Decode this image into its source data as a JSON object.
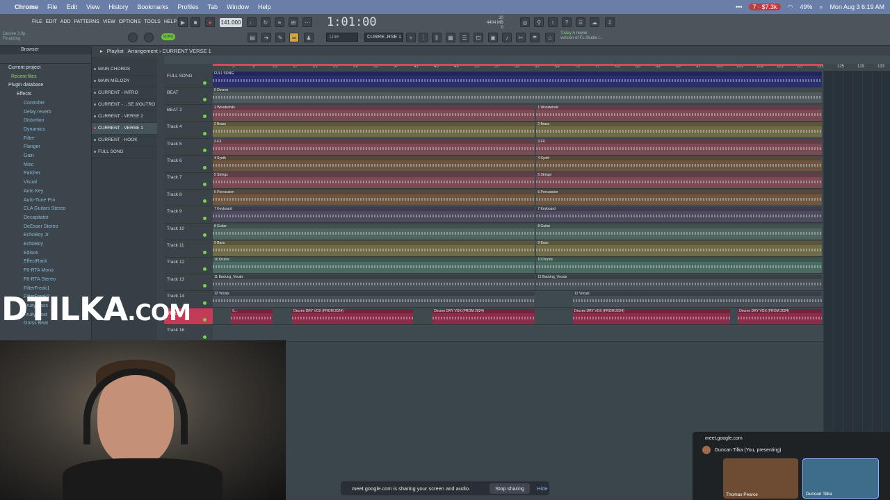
{
  "menubar": {
    "app": "Chrome",
    "items": [
      "File",
      "Edit",
      "View",
      "History",
      "Bookmarks",
      "Profiles",
      "Tab",
      "Window",
      "Help"
    ],
    "badge": "7 · $7.3k",
    "battery": "49%",
    "datetime": "Mon Aug 3  6:19 AM"
  },
  "fl": {
    "menu": [
      "FILE",
      "EDIT",
      "ADD",
      "PATTERNS",
      "VIEW",
      "OPTIONS",
      "TOOLS",
      "HELP"
    ],
    "hint": [
      "Decree 3.flp",
      "Finalizing"
    ],
    "song_toggle": "SONG",
    "bpm": "141.000",
    "time": "1:01:00",
    "cpu": [
      "10",
      "4404 MB",
      "0"
    ],
    "snap": "Line",
    "pattern": "CURRE..RSE 1",
    "news": [
      "Today",
      "A newer",
      "version of FL Studio i..."
    ]
  },
  "browser": {
    "title": "Browser",
    "items": [
      {
        "label": "Current project",
        "type": "folder"
      },
      {
        "label": "Recent files",
        "type": "green"
      },
      {
        "label": "Plugin database",
        "type": "folder"
      },
      {
        "label": "Effects",
        "type": "folder"
      },
      {
        "label": "Controller",
        "type": "blue"
      },
      {
        "label": "Delay reverb",
        "type": "blue"
      },
      {
        "label": "Distortion",
        "type": "blue"
      },
      {
        "label": "Dynamics",
        "type": "blue"
      },
      {
        "label": "Filter",
        "type": "blue"
      },
      {
        "label": "Flanger",
        "type": "blue"
      },
      {
        "label": "Gain",
        "type": "blue"
      },
      {
        "label": "Misc",
        "type": "blue"
      },
      {
        "label": "Patcher",
        "type": "blue"
      },
      {
        "label": "Visual",
        "type": "blue"
      },
      {
        "label": "Auto Key",
        "type": "blue"
      },
      {
        "label": "Auto-Tune Pro",
        "type": "blue"
      },
      {
        "label": "CLA Guitars Stereo",
        "type": "blue"
      },
      {
        "label": "Decapitator",
        "type": "blue"
      },
      {
        "label": "DeEsser Stereo",
        "type": "blue"
      },
      {
        "label": "EchoBoy Jr",
        "type": "blue"
      },
      {
        "label": "EchoBoy",
        "type": "blue"
      },
      {
        "label": "Edison",
        "type": "blue"
      },
      {
        "label": "EffectRack",
        "type": "blue"
      },
      {
        "label": "F6-RTA Mono",
        "type": "blue"
      },
      {
        "label": "F6-RTA Stereo",
        "type": "blue"
      },
      {
        "label": "FilterFreak1",
        "type": "blue"
      },
      {
        "label": "FilterFreak2",
        "type": "blue"
      },
      {
        "label": "Fruity Bass",
        "type": "blue"
      },
      {
        "label": "Fruity Beat",
        "type": "blue"
      },
      {
        "label": "Gross Beat",
        "type": "blue"
      }
    ]
  },
  "patterns": [
    "MAIN CHORDS",
    "MAIN MELODY",
    "CURRENT - INTRO",
    "CURRENT - ...SE 3/OUTRO",
    "CURRENT - VERSE 2",
    "CURRENT - VERSE 1",
    "CURRENT - HOOK",
    "FULL SONG"
  ],
  "active_pattern": "CURRENT - VERSE 1",
  "playlist": {
    "title": "Playlist",
    "breadcrumb": "Arrangement  ›  CURRENT  VERSE 1",
    "ruler": [
      "5",
      "9",
      "13",
      "17",
      "21",
      "25",
      "29",
      "33",
      "37",
      "41",
      "45",
      "49",
      "53",
      "57",
      "61",
      "65",
      "69",
      "73",
      "77",
      "81",
      "85",
      "89",
      "93",
      "97",
      "101",
      "105",
      "109",
      "113",
      "117",
      "121",
      "125",
      "129",
      "133"
    ],
    "tracks": [
      {
        "name": "FULL SONG",
        "color": "#2b2e6e",
        "clips": [
          {
            "label": "FULL SONG",
            "start": 0,
            "len": 1
          }
        ]
      },
      {
        "name": "BEAT",
        "color": "#50595d",
        "clips": [
          {
            "label": "0 Decree",
            "start": 0,
            "len": 1
          }
        ]
      },
      {
        "name": "BEAT 2",
        "color": "#7a4a55",
        "clips": [
          {
            "label": "1 Woodwinds",
            "start": 0,
            "len": 0.53
          },
          {
            "label": "1 Woodwinds",
            "start": 0.53,
            "len": 0.47
          }
        ]
      },
      {
        "name": "Track 4",
        "color": "#6f6a47",
        "clips": [
          {
            "label": "2 Brass",
            "start": 0,
            "len": 0.53
          },
          {
            "label": "2 Brass",
            "start": 0.53,
            "len": 0.47
          }
        ]
      },
      {
        "name": "Track 5",
        "color": "#7a4a55",
        "clips": [
          {
            "label": "3 FX",
            "start": 0,
            "len": 0.53
          },
          {
            "label": "3 FX",
            "start": 0.53,
            "len": 0.47
          }
        ]
      },
      {
        "name": "Track 6",
        "color": "#6c5642",
        "clips": [
          {
            "label": "4 Synth",
            "start": 0,
            "len": 0.53
          },
          {
            "label": "4 Synth",
            "start": 0.53,
            "len": 0.47
          }
        ]
      },
      {
        "name": "Track 7",
        "color": "#7a4a55",
        "clips": [
          {
            "label": "5 Strings",
            "start": 0,
            "len": 0.53
          },
          {
            "label": "5 Strings",
            "start": 0.53,
            "len": 0.47
          }
        ]
      },
      {
        "name": "Track 8",
        "color": "#6c5642",
        "clips": [
          {
            "label": "6 Percussion",
            "start": 0,
            "len": 0.53
          },
          {
            "label": "6 Percussion",
            "start": 0.53,
            "len": 0.47
          }
        ]
      },
      {
        "name": "Track 9",
        "color": "#4d4a5e",
        "clips": [
          {
            "label": "7 Keyboard",
            "start": 0,
            "len": 0.53
          },
          {
            "label": "7 Keyboard",
            "start": 0.53,
            "len": 0.47
          }
        ]
      },
      {
        "name": "Track 10",
        "color": "#50655f",
        "clips": [
          {
            "label": "8 Guitar",
            "start": 0,
            "len": 0.53
          },
          {
            "label": "8 Guitar",
            "start": 0.53,
            "len": 0.47
          }
        ]
      },
      {
        "name": "Track 11",
        "color": "#6f6a47",
        "clips": [
          {
            "label": "9 Bass",
            "start": 0,
            "len": 0.53
          },
          {
            "label": "9 Bass",
            "start": 0.53,
            "len": 0.47
          }
        ]
      },
      {
        "name": "Track 12",
        "color": "#4a6a62",
        "clips": [
          {
            "label": "10 Drums",
            "start": 0,
            "len": 0.53
          },
          {
            "label": "10 Drums",
            "start": 0.53,
            "len": 0.47
          }
        ]
      },
      {
        "name": "Track 13",
        "color": "#454f55",
        "clips": [
          {
            "label": "11 Backing_Vocals",
            "start": 0,
            "len": 0.53
          },
          {
            "label": "11 Backing_Vocals",
            "start": 0.53,
            "len": 0.47
          }
        ]
      },
      {
        "name": "Track 14",
        "color": "#454f55",
        "clips": [
          {
            "label": "12 Vocals",
            "start": 0,
            "len": 0.53
          },
          {
            "label": "12 Vocals",
            "start": 0.59,
            "len": 0.41
          }
        ]
      },
      {
        "name": "VERSE",
        "color": "#8a2d4a",
        "clips": [
          {
            "label": "0...",
            "start": 0.03,
            "len": 0.07
          },
          {
            "label": "Decree DRY VOX (FROM 2024)",
            "start": 0.13,
            "len": 0.2
          },
          {
            "label": "Decree DRY VOX (FROM 2024)",
            "start": 0.36,
            "len": 0.17
          },
          {
            "label": "Decree DRY VOX (FROM 2024)",
            "start": 0.59,
            "len": 0.26
          },
          {
            "label": "Decree DRY VOX (FROM 2024)",
            "start": 0.86,
            "len": 0.14
          }
        ]
      },
      {
        "name": "Track 16",
        "color": "#3f4a4f",
        "clips": []
      }
    ]
  },
  "watermark": {
    "big": "DTILKA",
    "small": ".COM"
  },
  "sharebar": {
    "text": "meet.google.com is sharing your screen and audio.",
    "stop": "Stop sharing",
    "hide": "Hide"
  },
  "meet": {
    "url": "meet.google.com",
    "presenter": "Duncan Tilka (You, presenting)",
    "tiles": [
      "Thomas Pearce",
      "Duncan Tilka"
    ]
  }
}
